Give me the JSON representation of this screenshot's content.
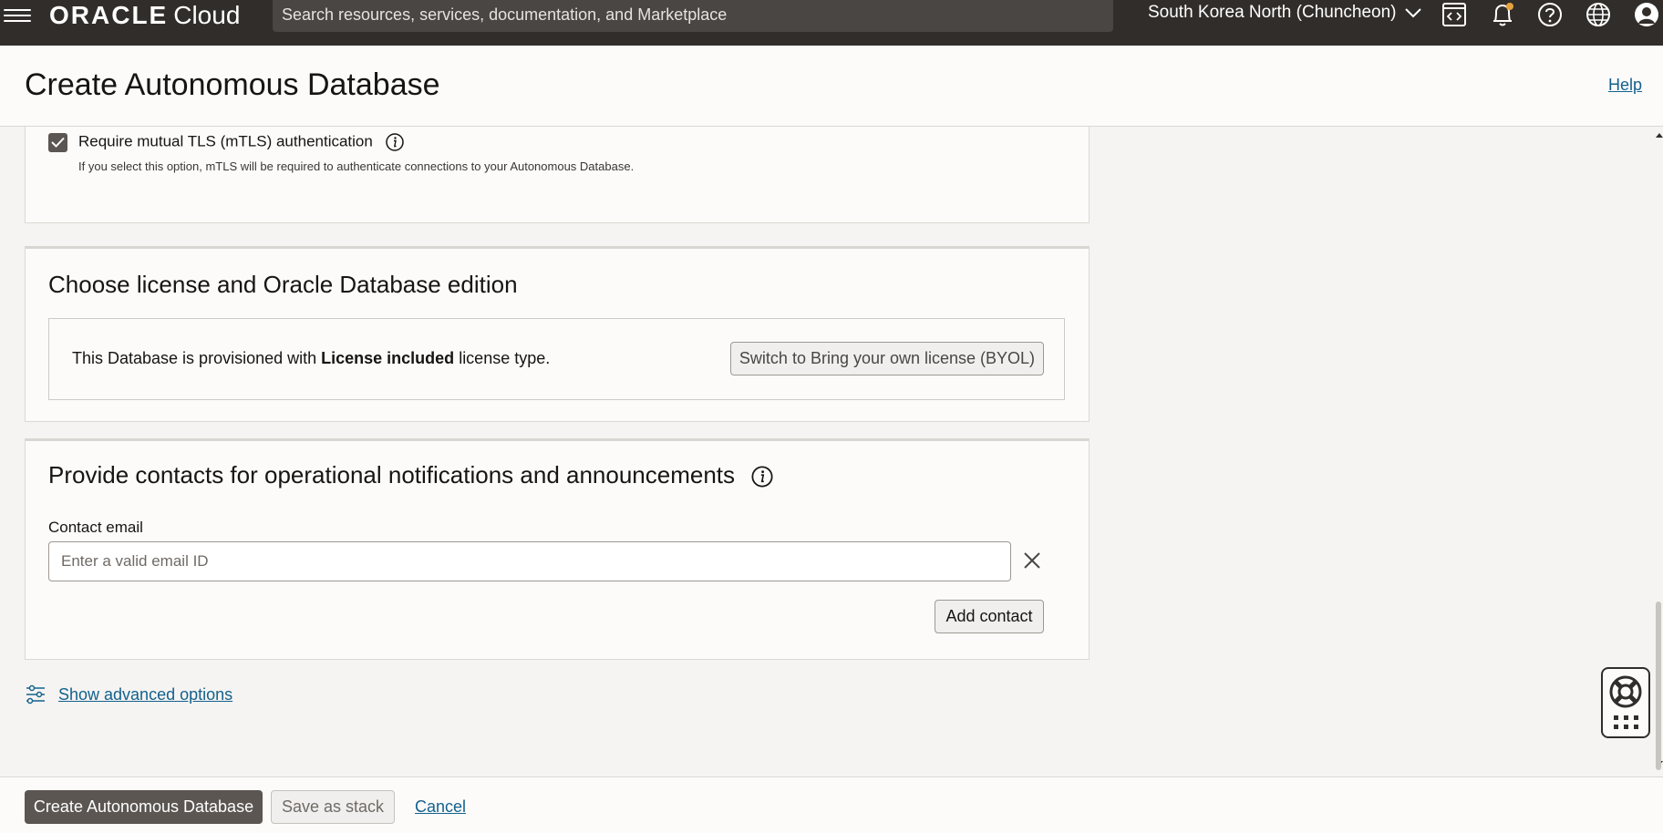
{
  "topbar": {
    "brand": "ORACLE",
    "product": "Cloud",
    "search_placeholder": "Search resources, services, documentation, and Marketplace",
    "region": "South Korea North (Chuncheon)"
  },
  "header": {
    "title": "Create Autonomous Database",
    "help_label": "Help"
  },
  "mtls": {
    "checked": true,
    "label": "Require mutual TLS (mTLS) authentication",
    "help_text": "If you select this option, mTLS will be required to authenticate connections to your Autonomous Database."
  },
  "license": {
    "title": "Choose license and Oracle Database edition",
    "text_prefix": "This Database is provisioned with ",
    "text_bold": "License included",
    "text_suffix": " license type.",
    "switch_button": "Switch to Bring your own license (BYOL)"
  },
  "contacts": {
    "title": "Provide contacts for operational notifications and announcements",
    "email_label": "Contact email",
    "email_value": "",
    "email_placeholder": "Enter a valid email ID",
    "add_button": "Add contact"
  },
  "advanced": {
    "label": "Show advanced options"
  },
  "footer": {
    "create_button": "Create Autonomous Database",
    "stack_button": "Save as stack",
    "cancel_link": "Cancel"
  },
  "colors": {
    "topbar_bg": "#312d2a",
    "primary_button": "#5b5652",
    "link": "#14618e"
  }
}
